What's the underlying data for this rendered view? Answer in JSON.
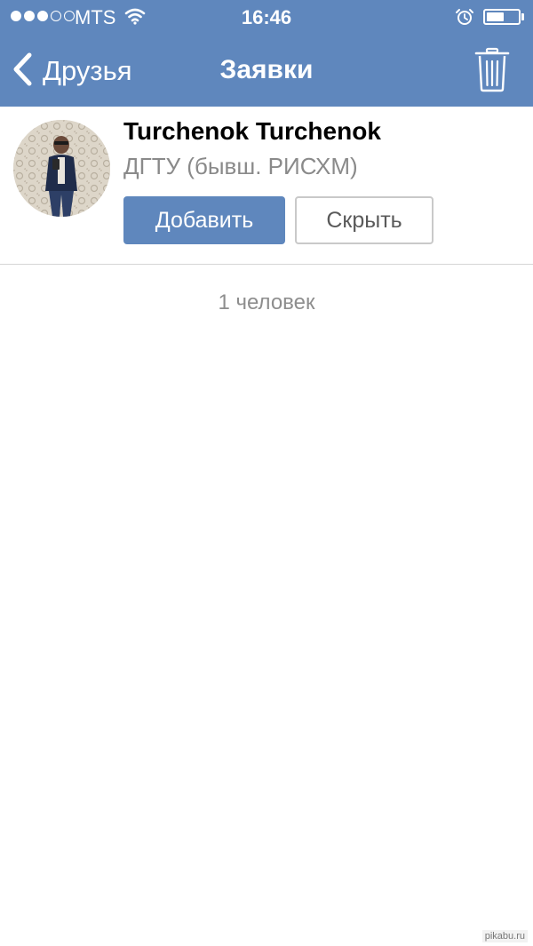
{
  "status_bar": {
    "signal_dots": [
      "filled",
      "filled",
      "filled",
      "empty",
      "empty"
    ],
    "carrier": "MTS",
    "wifi_icon": "wifi-icon",
    "time": "16:46",
    "alarm_icon": "alarm-clock-icon",
    "battery_level": 0.55
  },
  "nav": {
    "back_icon": "chevron-left-icon",
    "back_label": "Друзья",
    "title": "Заявки",
    "trash_icon": "trash-icon"
  },
  "request": {
    "name": "Turchenok Turchenok",
    "subtitle": "ДГТУ (бывш. РИСХМ)",
    "add_label": "Добавить",
    "hide_label": "Скрыть"
  },
  "footer_count": "1 человек",
  "watermark": "pikabu.ru",
  "colors": {
    "nav_blue": "#5f87bd",
    "button_blue": "#5f87bd",
    "subtitle_gray": "#8a8a8a",
    "divider": "#d6d6d6"
  }
}
